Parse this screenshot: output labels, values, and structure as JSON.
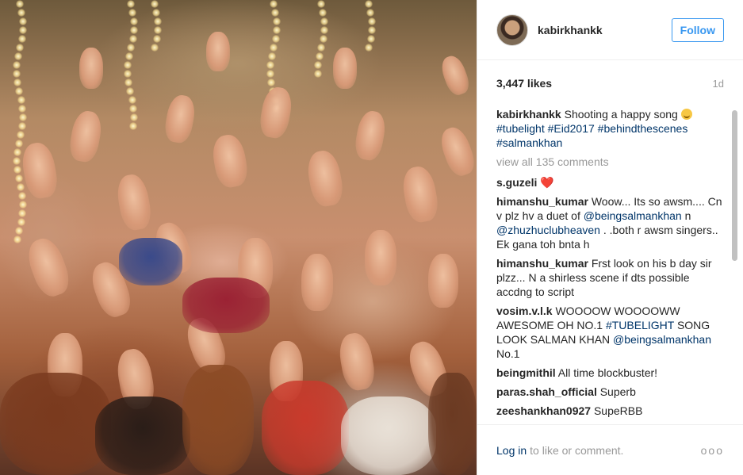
{
  "post": {
    "username": "kabirkhankk",
    "follow_label": "Follow",
    "likes": "3,447 likes",
    "time_ago": "1d",
    "caption": {
      "author": "kabirkhankk",
      "text": "Shooting a happy song",
      "emoji": "smiling-face-icon",
      "hashtags": [
        "#tubelight",
        "#Eid2017",
        "#behindthescenes",
        "#salmankhan"
      ]
    },
    "view_all": "view all 135 comments",
    "comments": [
      {
        "author": "s.guzeli",
        "text": "",
        "emoji": "❤️"
      },
      {
        "author": "himanshu_kumar",
        "text_before": "Woow... Its so awsm.... Cn v plz hv a duet of",
        "mention1": "@beingsalmankhan",
        "text_mid": "n",
        "mention2": "@zhuzhuclubheaven",
        "text_after": ". .both r awsm singers.. Ek gana toh bnta h"
      },
      {
        "author": "himanshu_kumar",
        "text": "Frst look on his b day sir plzz... N a shirless scene if dts possible accdng to script"
      },
      {
        "author": "vosim.v.l.k",
        "text_before": "WOOOOW WOOOOWW AWESOME OH NO.1",
        "hashtag": "#TUBELIGHT",
        "text_mid": "SONG LOOK SALMAN KHAN",
        "mention": "@beingsalmankhan",
        "text_after": "No.1"
      },
      {
        "author": "beingmithil",
        "text": "All time blockbuster!"
      },
      {
        "author": "paras.shah_official",
        "text": "Superb"
      },
      {
        "author": "zeeshankhan0927",
        "text": "SupeRBB"
      }
    ],
    "footer": {
      "login_label": "Log in",
      "suffix": "to like or comment.",
      "more": "ooo"
    }
  },
  "colors": {
    "link": "#003569",
    "accent": "#3897f0",
    "muted": "#999999"
  }
}
